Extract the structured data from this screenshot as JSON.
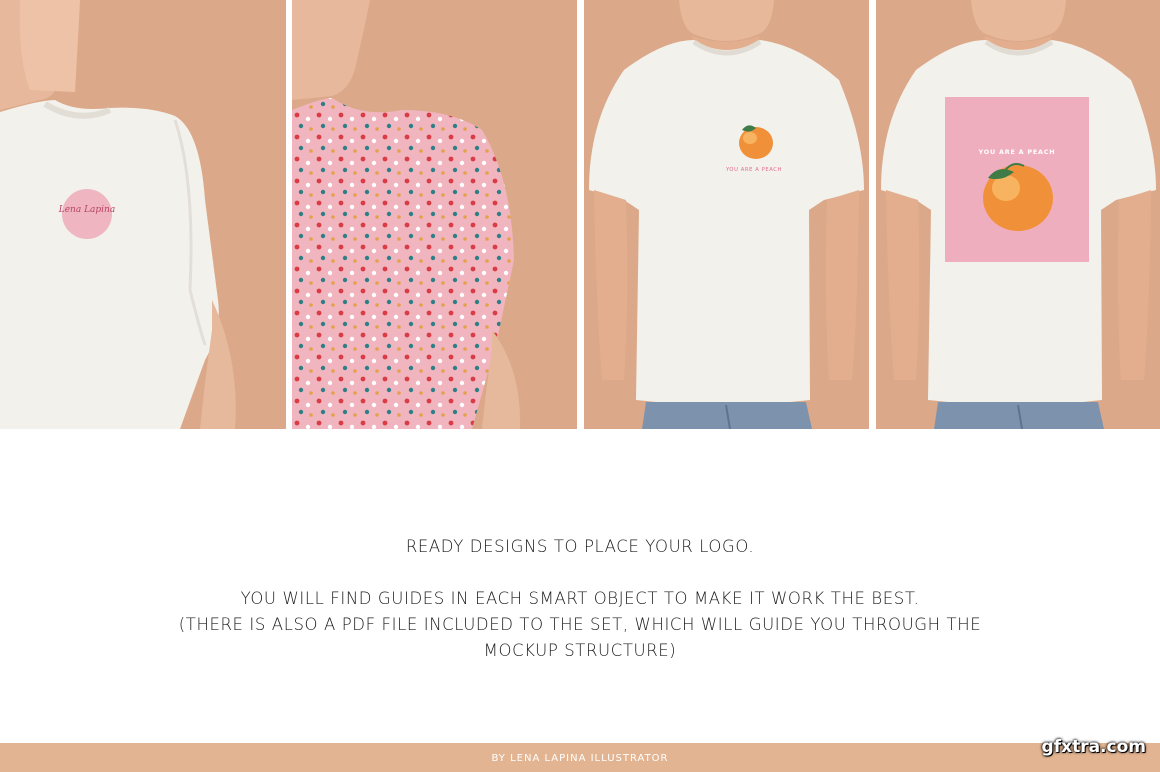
{
  "panels": [
    {
      "name": "panel-logo-mockup",
      "logo_text": "Lena Lapina"
    },
    {
      "name": "panel-floral-pattern-mockup"
    },
    {
      "name": "panel-small-peach-print",
      "print_text": "YOU ARE A PEACH"
    },
    {
      "name": "panel-large-peach-print",
      "print_text": "YOU ARE A PEACH"
    }
  ],
  "caption": {
    "line1": "READY DESIGNS TO PLACE YOUR LOGO.",
    "line2": "YOU WILL FIND GUIDES IN EACH SMART OBJECT TO MAKE IT WORK THE BEST.",
    "line3": "(THERE IS ALSO A PDF FILE INCLUDED TO THE SET, WHICH WILL GUIDE YOU THROUGH THE",
    "line4": "MOCKUP STRUCTURE)"
  },
  "footer": {
    "credit": "BY LENA LAPINA ILLUSTRATOR"
  },
  "watermark": "gfxtra.com",
  "colors": {
    "background": "#dba98a",
    "shirt": "#f3f1ec",
    "pink": "#eeaebd",
    "peach": "#f0913a",
    "footer": "#e2b491"
  }
}
